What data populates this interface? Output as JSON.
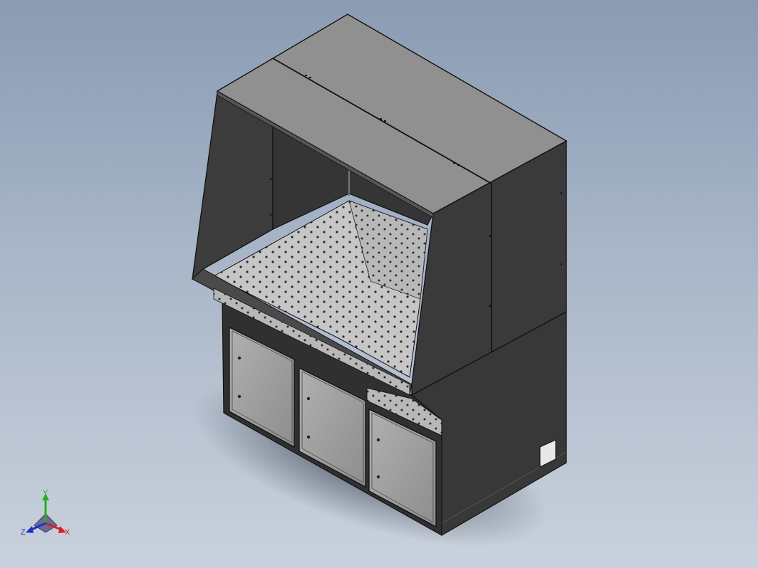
{
  "viewport": {
    "background_top": "#8a9bb3",
    "background_bottom": "#c9d1dc"
  },
  "model": {
    "name": "fume-extraction-workbench",
    "body_color": "#3a3a3a",
    "top_color": "#8f8f8f",
    "perforated_color": "#c4c4c4",
    "door_color": "#9c9c9c",
    "edge_color": "#111111"
  },
  "triad": {
    "x_label": "X",
    "y_label": "Y",
    "z_label": "Z",
    "x_color": "#d42020",
    "y_color": "#20b020",
    "z_color": "#2030c8"
  }
}
